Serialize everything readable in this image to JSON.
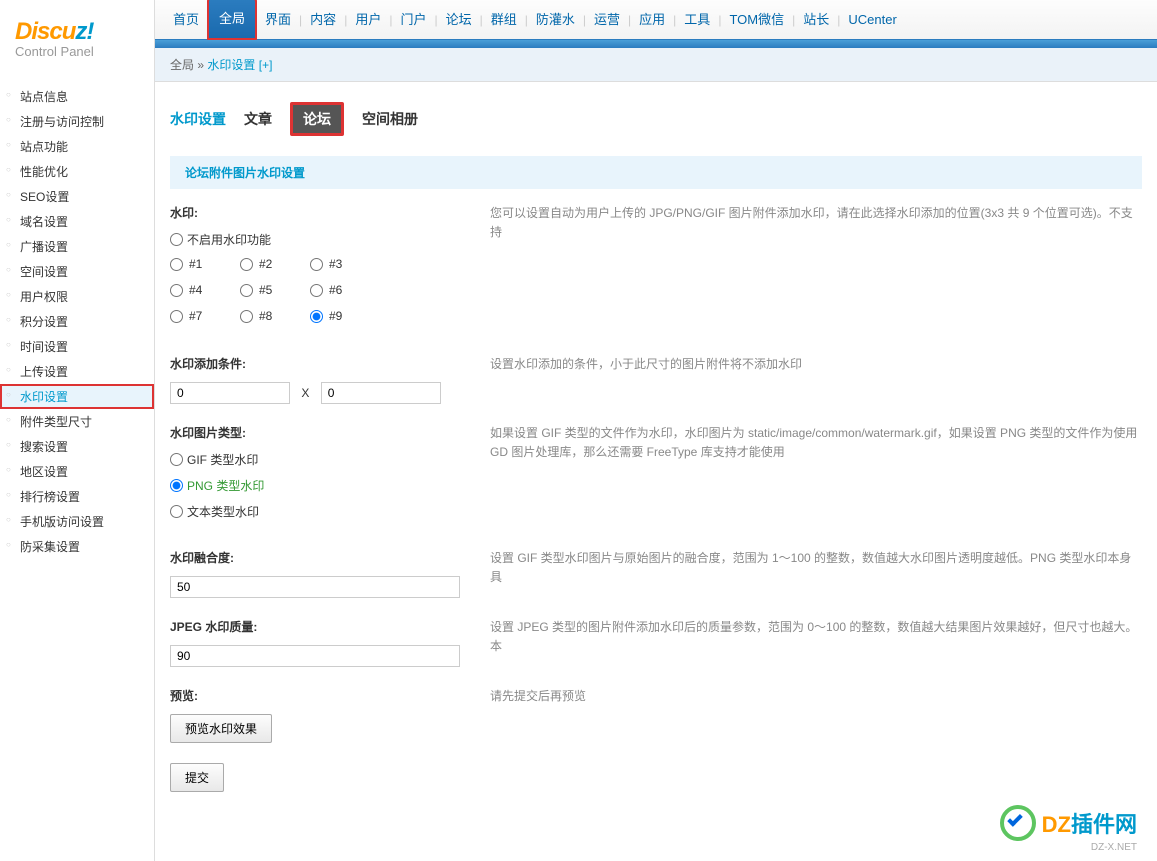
{
  "logo": {
    "part1": "Discu",
    "part2": "z",
    "excl": "!",
    "sub": "Control Panel"
  },
  "sideMenu": [
    {
      "label": "站点信息"
    },
    {
      "label": "注册与访问控制"
    },
    {
      "label": "站点功能"
    },
    {
      "label": "性能优化"
    },
    {
      "label": "SEO设置"
    },
    {
      "label": "域名设置"
    },
    {
      "label": "广播设置"
    },
    {
      "label": "空间设置"
    },
    {
      "label": "用户权限"
    },
    {
      "label": "积分设置"
    },
    {
      "label": "时间设置"
    },
    {
      "label": "上传设置"
    },
    {
      "label": "水印设置",
      "active": true
    },
    {
      "label": "附件类型尺寸"
    },
    {
      "label": "搜索设置"
    },
    {
      "label": "地区设置"
    },
    {
      "label": "排行榜设置"
    },
    {
      "label": "手机版访问设置"
    },
    {
      "label": "防采集设置"
    }
  ],
  "topnav": [
    {
      "label": "首页"
    },
    {
      "label": "全局",
      "active": true
    },
    {
      "label": "界面"
    },
    {
      "label": "内容"
    },
    {
      "label": "用户"
    },
    {
      "label": "门户"
    },
    {
      "label": "论坛"
    },
    {
      "label": "群组"
    },
    {
      "label": "防灌水"
    },
    {
      "label": "运营"
    },
    {
      "label": "应用"
    },
    {
      "label": "工具"
    },
    {
      "label": "TOM微信"
    },
    {
      "label": "站长"
    },
    {
      "label": "UCenter"
    }
  ],
  "breadcrumb": {
    "root": "全局",
    "sep": "»",
    "page": "水印设置",
    "extra": "[+]"
  },
  "tabs": [
    {
      "label": "水印设置",
      "type": "active"
    },
    {
      "label": "文章",
      "type": "normal"
    },
    {
      "label": "论坛",
      "type": "boxed"
    },
    {
      "label": "空间相册",
      "type": "normal"
    }
  ],
  "sectionTitle": "论坛附件图片水印设置",
  "watermark": {
    "label": "水印:",
    "disable": "不启用水印功能",
    "positions": [
      "#1",
      "#2",
      "#3",
      "#4",
      "#5",
      "#6",
      "#7",
      "#8",
      "#9"
    ],
    "selected": "#9",
    "desc": "您可以设置自动为用户上传的 JPG/PNG/GIF 图片附件添加水印，请在此选择水印添加的位置(3x3 共 9 个位置可选)。不支持"
  },
  "condition": {
    "label": "水印添加条件:",
    "w": "0",
    "h": "0",
    "desc": "设置水印添加的条件，小于此尺寸的图片附件将不添加水印"
  },
  "imgType": {
    "label": "水印图片类型:",
    "options": [
      "GIF 类型水印",
      "PNG 类型水印",
      "文本类型水印"
    ],
    "selected": "PNG 类型水印",
    "desc": "如果设置 GIF 类型的文件作为水印，水印图片为 static/image/common/watermark.gif，如果设置 PNG 类型的文件作为使用 GD 图片处理库，那么还需要 FreeType 库支持才能使用"
  },
  "opacity": {
    "label": "水印融合度:",
    "value": "50",
    "desc": "设置 GIF 类型水印图片与原始图片的融合度，范围为 1～100 的整数，数值越大水印图片透明度越低。PNG 类型水印本身具"
  },
  "jpeg": {
    "label": "JPEG 水印质量:",
    "value": "90",
    "desc": "设置 JPEG 类型的图片附件添加水印后的质量参数，范围为 0～100 的整数，数值越大结果图片效果越好，但尺寸也越大。本"
  },
  "preview": {
    "label": "预览:",
    "btn": "预览水印效果",
    "desc": "请先提交后再预览"
  },
  "submit": "提交",
  "wmLogo": {
    "t1": "DZ",
    "t2": "插件网",
    "sub": "DZ-X.NET"
  }
}
